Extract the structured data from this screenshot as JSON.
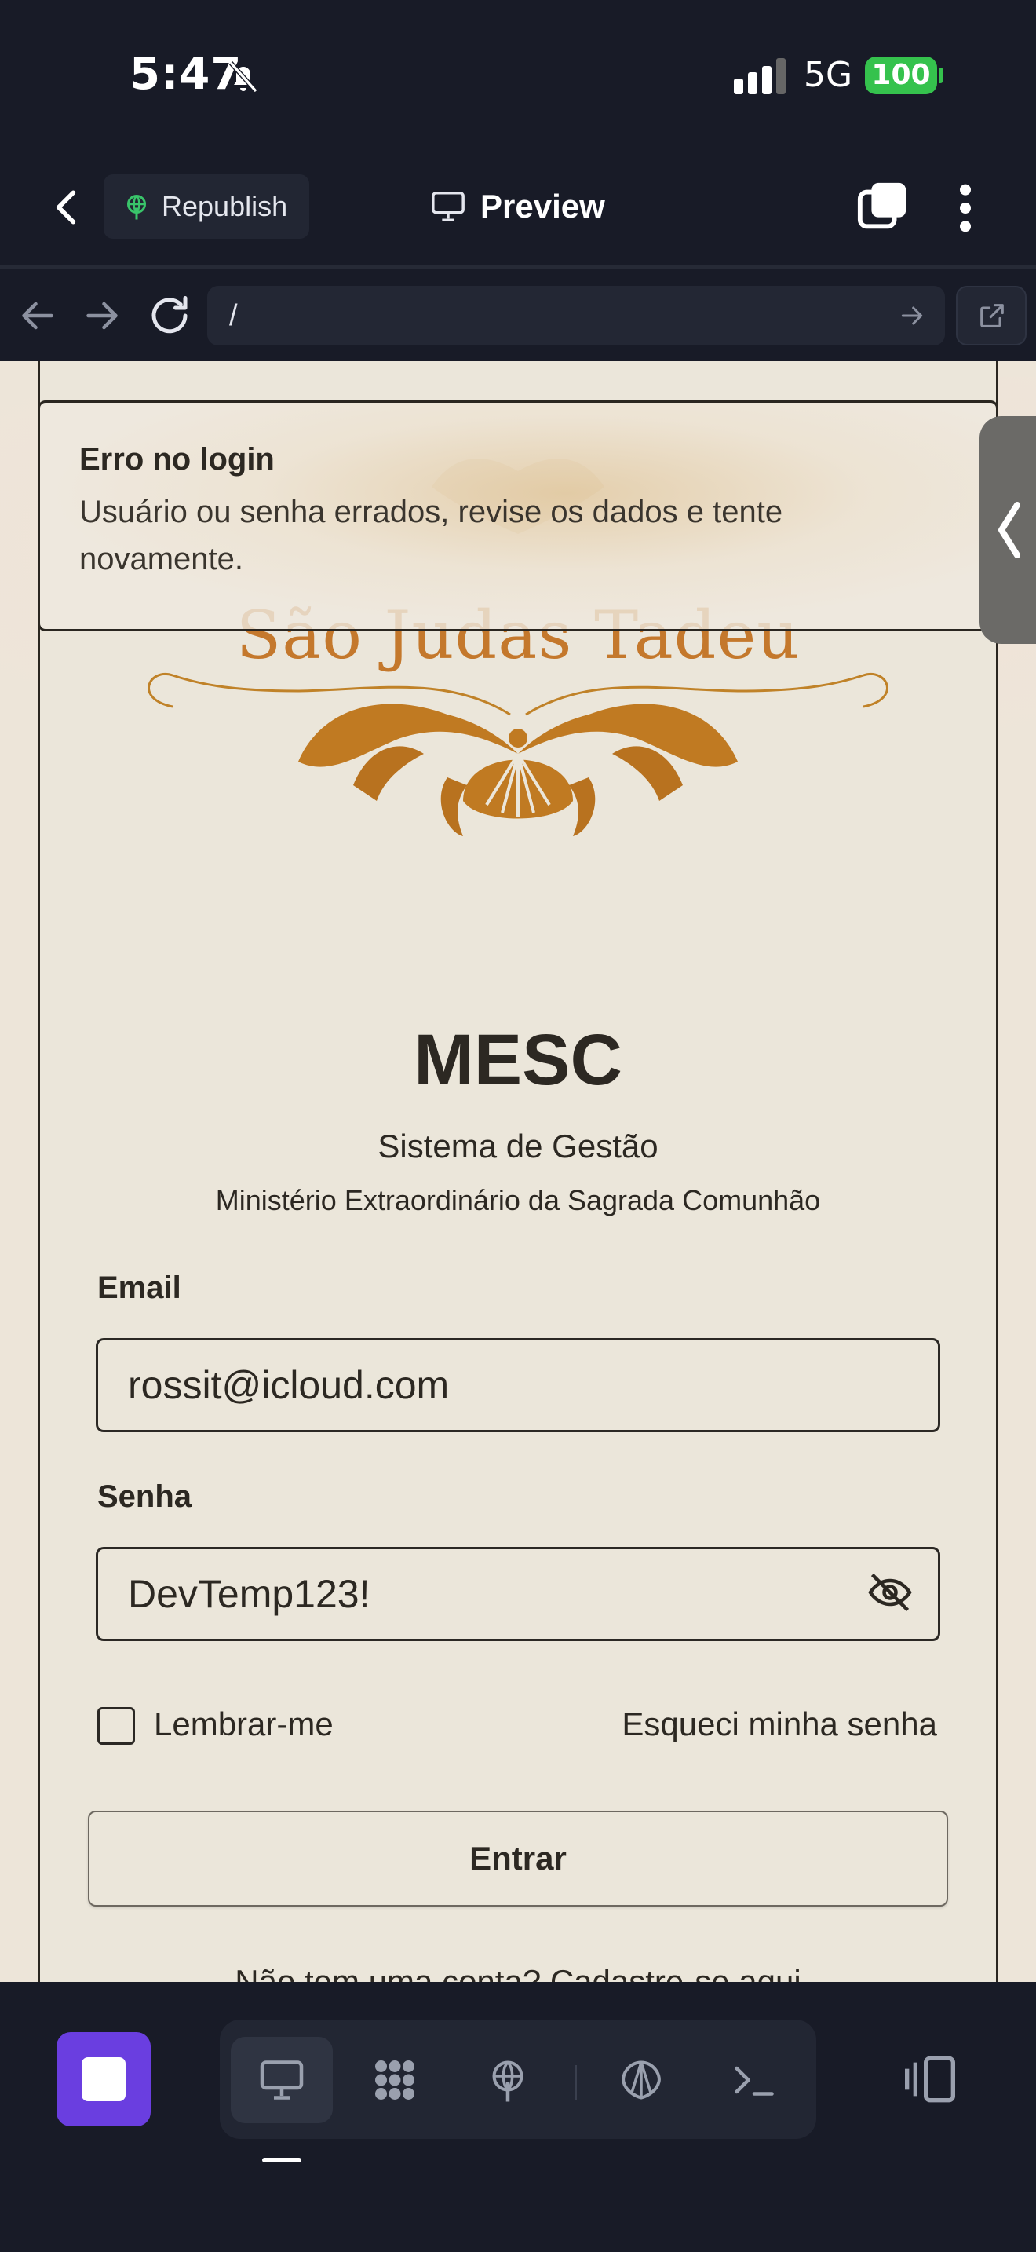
{
  "status_bar": {
    "time": "5:47",
    "network": "5G",
    "battery": "100"
  },
  "toolbar": {
    "republish_label": "Republish",
    "preview_label": "Preview"
  },
  "browser": {
    "url": "/"
  },
  "toast": {
    "title": "Erro no login",
    "message": "Usuário ou senha errados, revise os dados e tente novamente."
  },
  "logo": {
    "text": "São Judas Tadeu"
  },
  "brand": {
    "title": "MESC",
    "subtitle": "Sistema de Gestão",
    "ministry": "Ministério Extraordinário da Sagrada Comunhão"
  },
  "form": {
    "email_label": "Email",
    "email_value": "rossit@icloud.com",
    "password_label": "Senha",
    "password_value": "DevTemp123!",
    "remember_label": "Lembrar-me",
    "forgot_label": "Esqueci minha senha",
    "submit_label": "Entrar",
    "signup_text": "Não tem uma conta? Cadastre-se aqui"
  },
  "colors": {
    "accent_purple": "#6a3ee0",
    "logo_gold": "#c4782c",
    "battery_green": "#35c24d"
  },
  "dock": {
    "icons": [
      "stop-icon",
      "desktop-icon",
      "apps-icon",
      "publish-icon",
      "shell-icon",
      "terminal-icon",
      "panel-toggle-icon"
    ]
  }
}
